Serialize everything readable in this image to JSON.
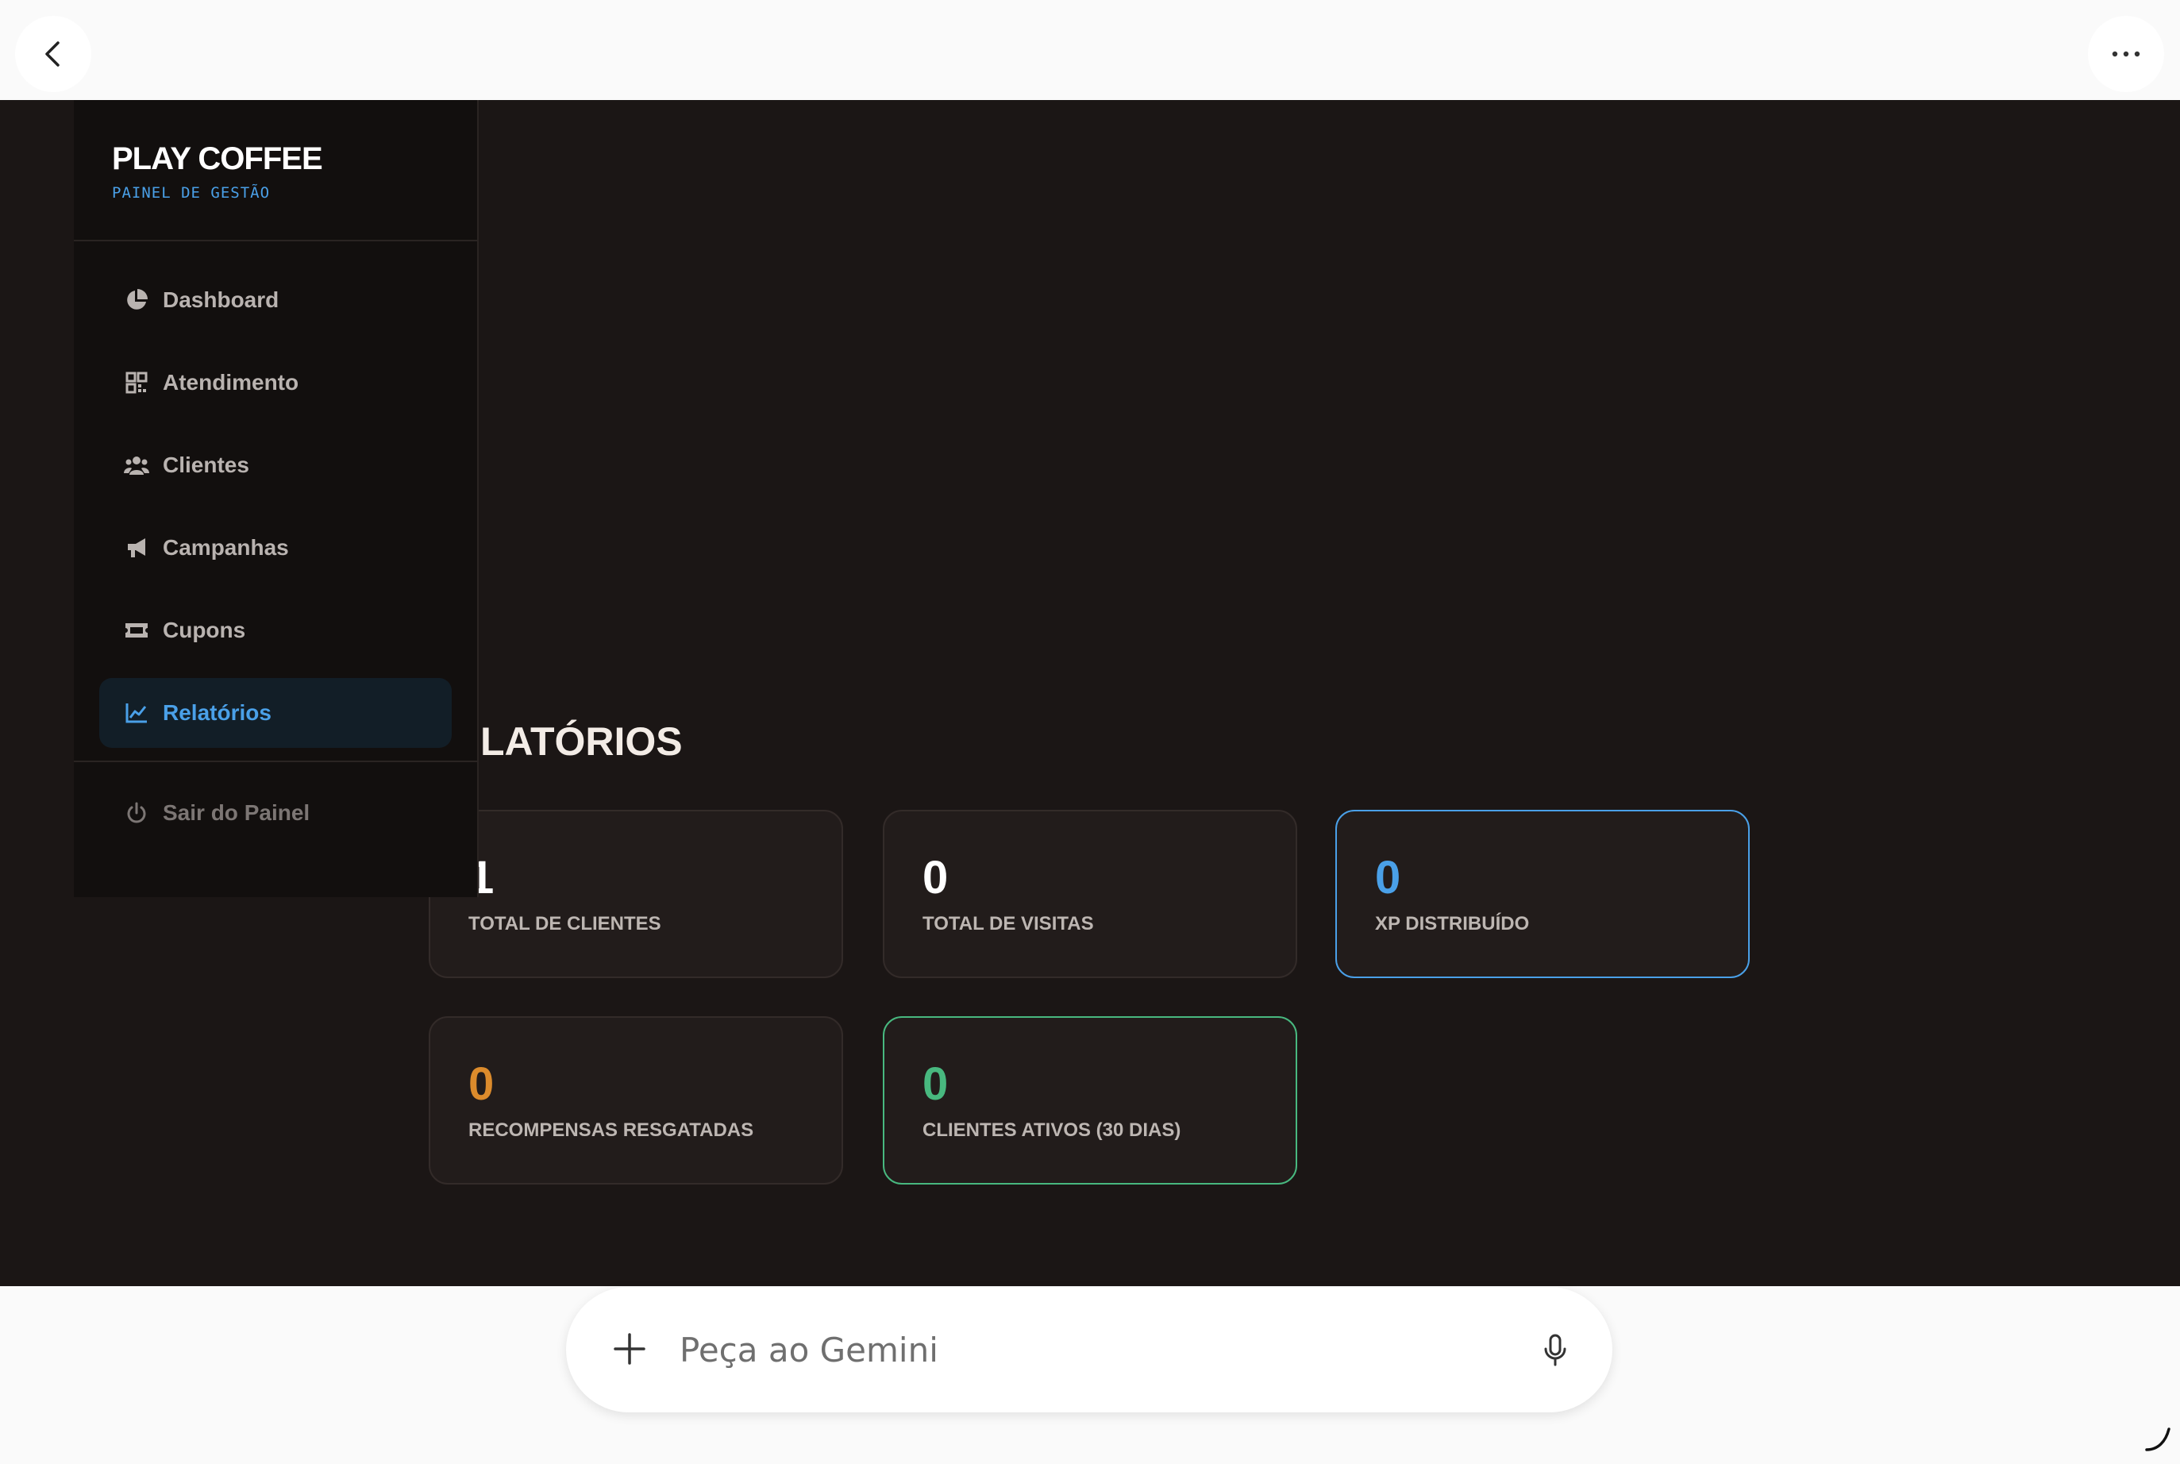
{
  "topbar": {
    "back_icon": "chevron-left-icon",
    "more_icon": "more-horizontal-icon"
  },
  "sidebar": {
    "brand_title": "PLAY COFFEE",
    "brand_subtitle": "PAINEL DE GESTÃO",
    "items": [
      {
        "label": "Dashboard",
        "icon": "pie-chart-icon",
        "active": false
      },
      {
        "label": "Atendimento",
        "icon": "qr-code-icon",
        "active": false
      },
      {
        "label": "Clientes",
        "icon": "users-icon",
        "active": false
      },
      {
        "label": "Campanhas",
        "icon": "megaphone-icon",
        "active": false
      },
      {
        "label": "Cupons",
        "icon": "ticket-icon",
        "active": false
      },
      {
        "label": "Relatórios",
        "icon": "line-chart-icon",
        "active": true
      }
    ],
    "logout_label": "Sair do Painel",
    "logout_icon": "power-icon"
  },
  "main": {
    "title": "LATÓRIOS",
    "cards": [
      {
        "value": "1",
        "label": "TOTAL DE CLIENTES",
        "color": "#ffffff"
      },
      {
        "value": "0",
        "label": "TOTAL DE VISITAS",
        "color": "#ffffff"
      },
      {
        "value": "0",
        "label": "XP DISTRIBUÍDO",
        "color": "#4aa0e8"
      },
      {
        "value": "0",
        "label": "RECOMPENSAS RESGATADAS",
        "color": "#dc8b2c"
      },
      {
        "value": "0",
        "label": "CLIENTES ATIVOS (30 DIAS)",
        "color": "#48b87f"
      }
    ]
  },
  "gemini": {
    "placeholder": "Peça ao Gemini",
    "plus_icon": "plus-icon",
    "mic_icon": "mic-icon"
  },
  "colors": {
    "background": "#1b1615",
    "sidebar": "#120f0e",
    "accent_blue": "#4aa0e8",
    "accent_orange": "#dc8b2c",
    "accent_green": "#48b87f"
  }
}
